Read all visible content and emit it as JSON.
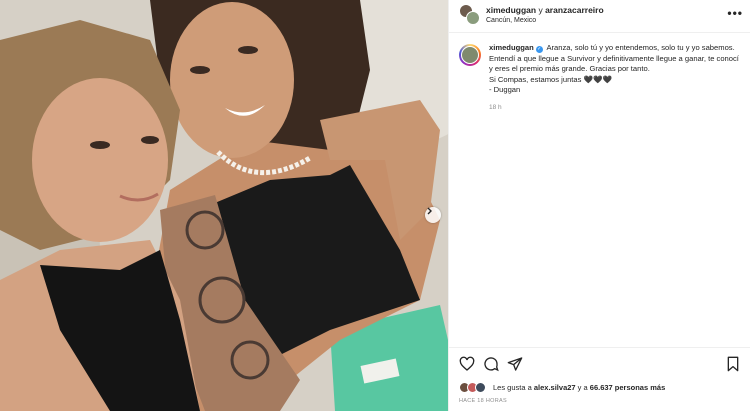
{
  "header": {
    "user1": "ximeduggan",
    "connector": "y",
    "user2": "aranzacarreiro",
    "location": "Cancún, Mexico",
    "more_icon": "more-horizontal-icon"
  },
  "caption": {
    "username": "ximeduggan",
    "verified_icon": "verified-badge-icon",
    "text_line1": "Aranza, solo tú y yo entendemos, solo tu y yo sabemos. Entendí a que llegue a Survivor y definitivamente llegue a ganar, te conocí y eres el premio más grande. Gracias por tanto.",
    "text_line2": "Si Compas, estamos juntas 🖤🖤🖤",
    "text_line3": "- Duggan",
    "time": "18 h"
  },
  "actions": {
    "like_icon": "heart-icon",
    "comment_icon": "comment-icon",
    "share_icon": "send-icon",
    "save_icon": "bookmark-icon"
  },
  "likes": {
    "prefix": "Les gusta a ",
    "user": "alex.silva27",
    "middle": " y a ",
    "count": "66.637 personas más"
  },
  "timestamp": "HACE 18 HORAS",
  "colors": {
    "verified": "#3897f0",
    "meta_text": "#8e8e8e",
    "primary_text": "#262626"
  }
}
